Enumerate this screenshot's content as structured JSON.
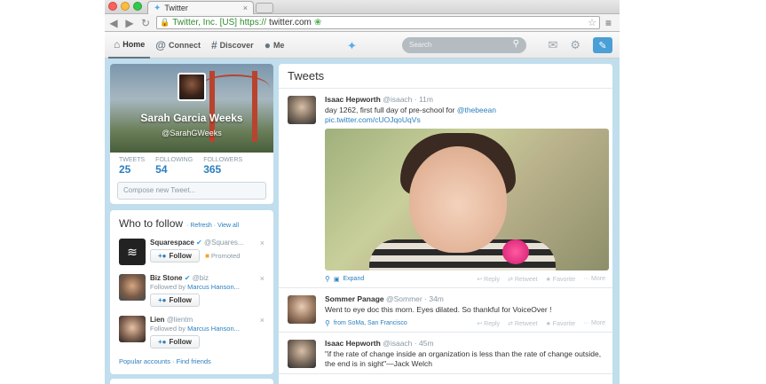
{
  "browser": {
    "tab_title": "Twitter",
    "tab_favicon": "twitter-bird-icon",
    "ev_label": "Twitter, Inc. [US]",
    "url_scheme": "https://",
    "url_host": "twitter.com"
  },
  "nav": {
    "home": "Home",
    "connect": "Connect",
    "discover": "Discover",
    "me": "Me",
    "search_placeholder": "Search"
  },
  "profile": {
    "name": "Sarah Garcia Weeks",
    "handle": "@SarahGWeeks",
    "stats": [
      {
        "label": "TWEETS",
        "value": "25"
      },
      {
        "label": "FOLLOWING",
        "value": "54"
      },
      {
        "label": "FOLLOWERS",
        "value": "365"
      }
    ],
    "compose_placeholder": "Compose new Tweet..."
  },
  "who_to_follow": {
    "title": "Who to follow",
    "refresh": "Refresh",
    "view_all": "View all",
    "follow_label": "Follow",
    "suggestions": [
      {
        "name": "Squarespace",
        "handle": "@Squares...",
        "promoted": "Promoted"
      },
      {
        "name": "Biz Stone",
        "handle": "@biz",
        "followed_by_prefix": "Followed by",
        "followed_by": "Marcus Hanson..."
      },
      {
        "name": "Lien",
        "handle": "@lientm",
        "followed_by_prefix": "Followed by",
        "followed_by": "Marcus Hanson..."
      }
    ],
    "popular_accounts": "Popular accounts",
    "find_friends": "Find friends"
  },
  "timeline": {
    "title": "Tweets",
    "actions": {
      "reply": "Reply",
      "retweet": "Retweet",
      "favorite": "Favorite",
      "more": "More"
    },
    "tweets": [
      {
        "name": "Isaac Hepworth",
        "handle": "@isaach",
        "time": "11m",
        "text": "day 1262, first full day of pre-school for",
        "mention": "@thebeean",
        "link": "pic.twitter.com/cUOJqoUqVs",
        "expand": "Expand"
      },
      {
        "name": "Sommer Panage",
        "handle": "@Sommer",
        "time": "34m",
        "text": "Went to eye doc this morn. Eyes dilated. So thankful for VoiceOver !",
        "location": "from SoMa, San Francisco"
      },
      {
        "name": "Isaac Hepworth",
        "handle": "@isaach",
        "time": "45m",
        "text": "\"if the rate of change inside an organization is less than the rate of change outside, the end is in sight\"—Jack Welch"
      }
    ]
  }
}
